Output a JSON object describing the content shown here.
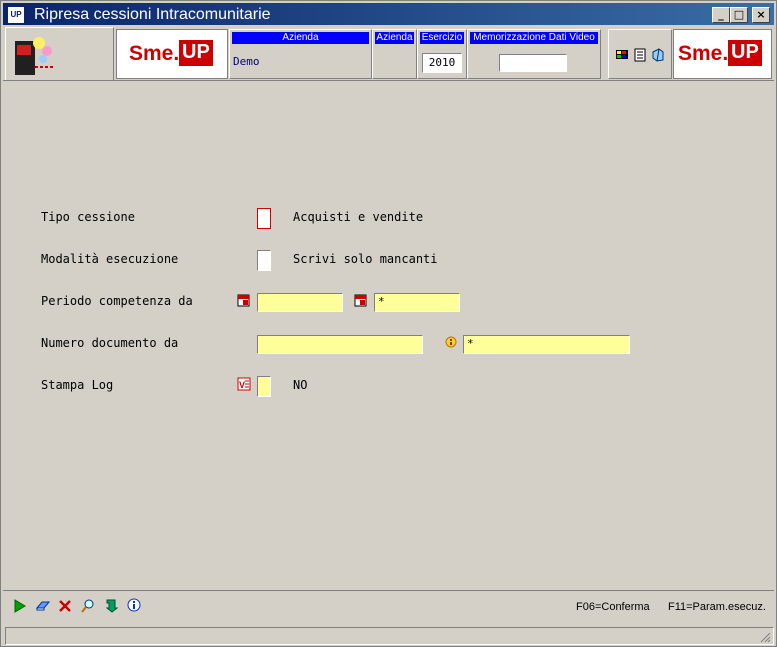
{
  "window": {
    "title": "Ripresa cessioni Intracomunitarie",
    "icon_text": "UP"
  },
  "title_buttons": {
    "minimize": "_",
    "maximize": "□",
    "close": "×"
  },
  "header": {
    "logo_left": {
      "sme": "Sme.",
      "up": "UP"
    },
    "logo_right": {
      "sme": "Sme.",
      "up": "UP"
    },
    "azienda_label": "Azienda",
    "azienda_value": "Demo",
    "azienda2_label": "Azienda",
    "esercizio_label": "Esercizio",
    "esercizio_value": "2010",
    "memorizzazione_label": "Memorizzazione Dati Video",
    "memorizzazione_value": ""
  },
  "form": {
    "tipo_cessione": {
      "label": "Tipo cessione",
      "value": "",
      "description": "Acquisti e vendite"
    },
    "modalita": {
      "label": "Modalità esecuzione",
      "value": "",
      "description": "Scrivi solo mancanti"
    },
    "periodo": {
      "label": "Periodo competenza da",
      "from": "",
      "to": "*"
    },
    "numero": {
      "label": "Numero documento   da",
      "from": "",
      "to": "*"
    },
    "stampa_log": {
      "label": "Stampa Log",
      "value": "",
      "description": "NO"
    }
  },
  "footer": {
    "fkeys": [
      "F06=Conferma",
      "F11=Param.esecuz."
    ],
    "status": ""
  },
  "colors": {
    "title_start": "#0a246a",
    "title_end": "#3a6ea5",
    "header_blue": "#0000ff",
    "field_yellow": "#ffff99",
    "brand_red": "#cc0000"
  }
}
